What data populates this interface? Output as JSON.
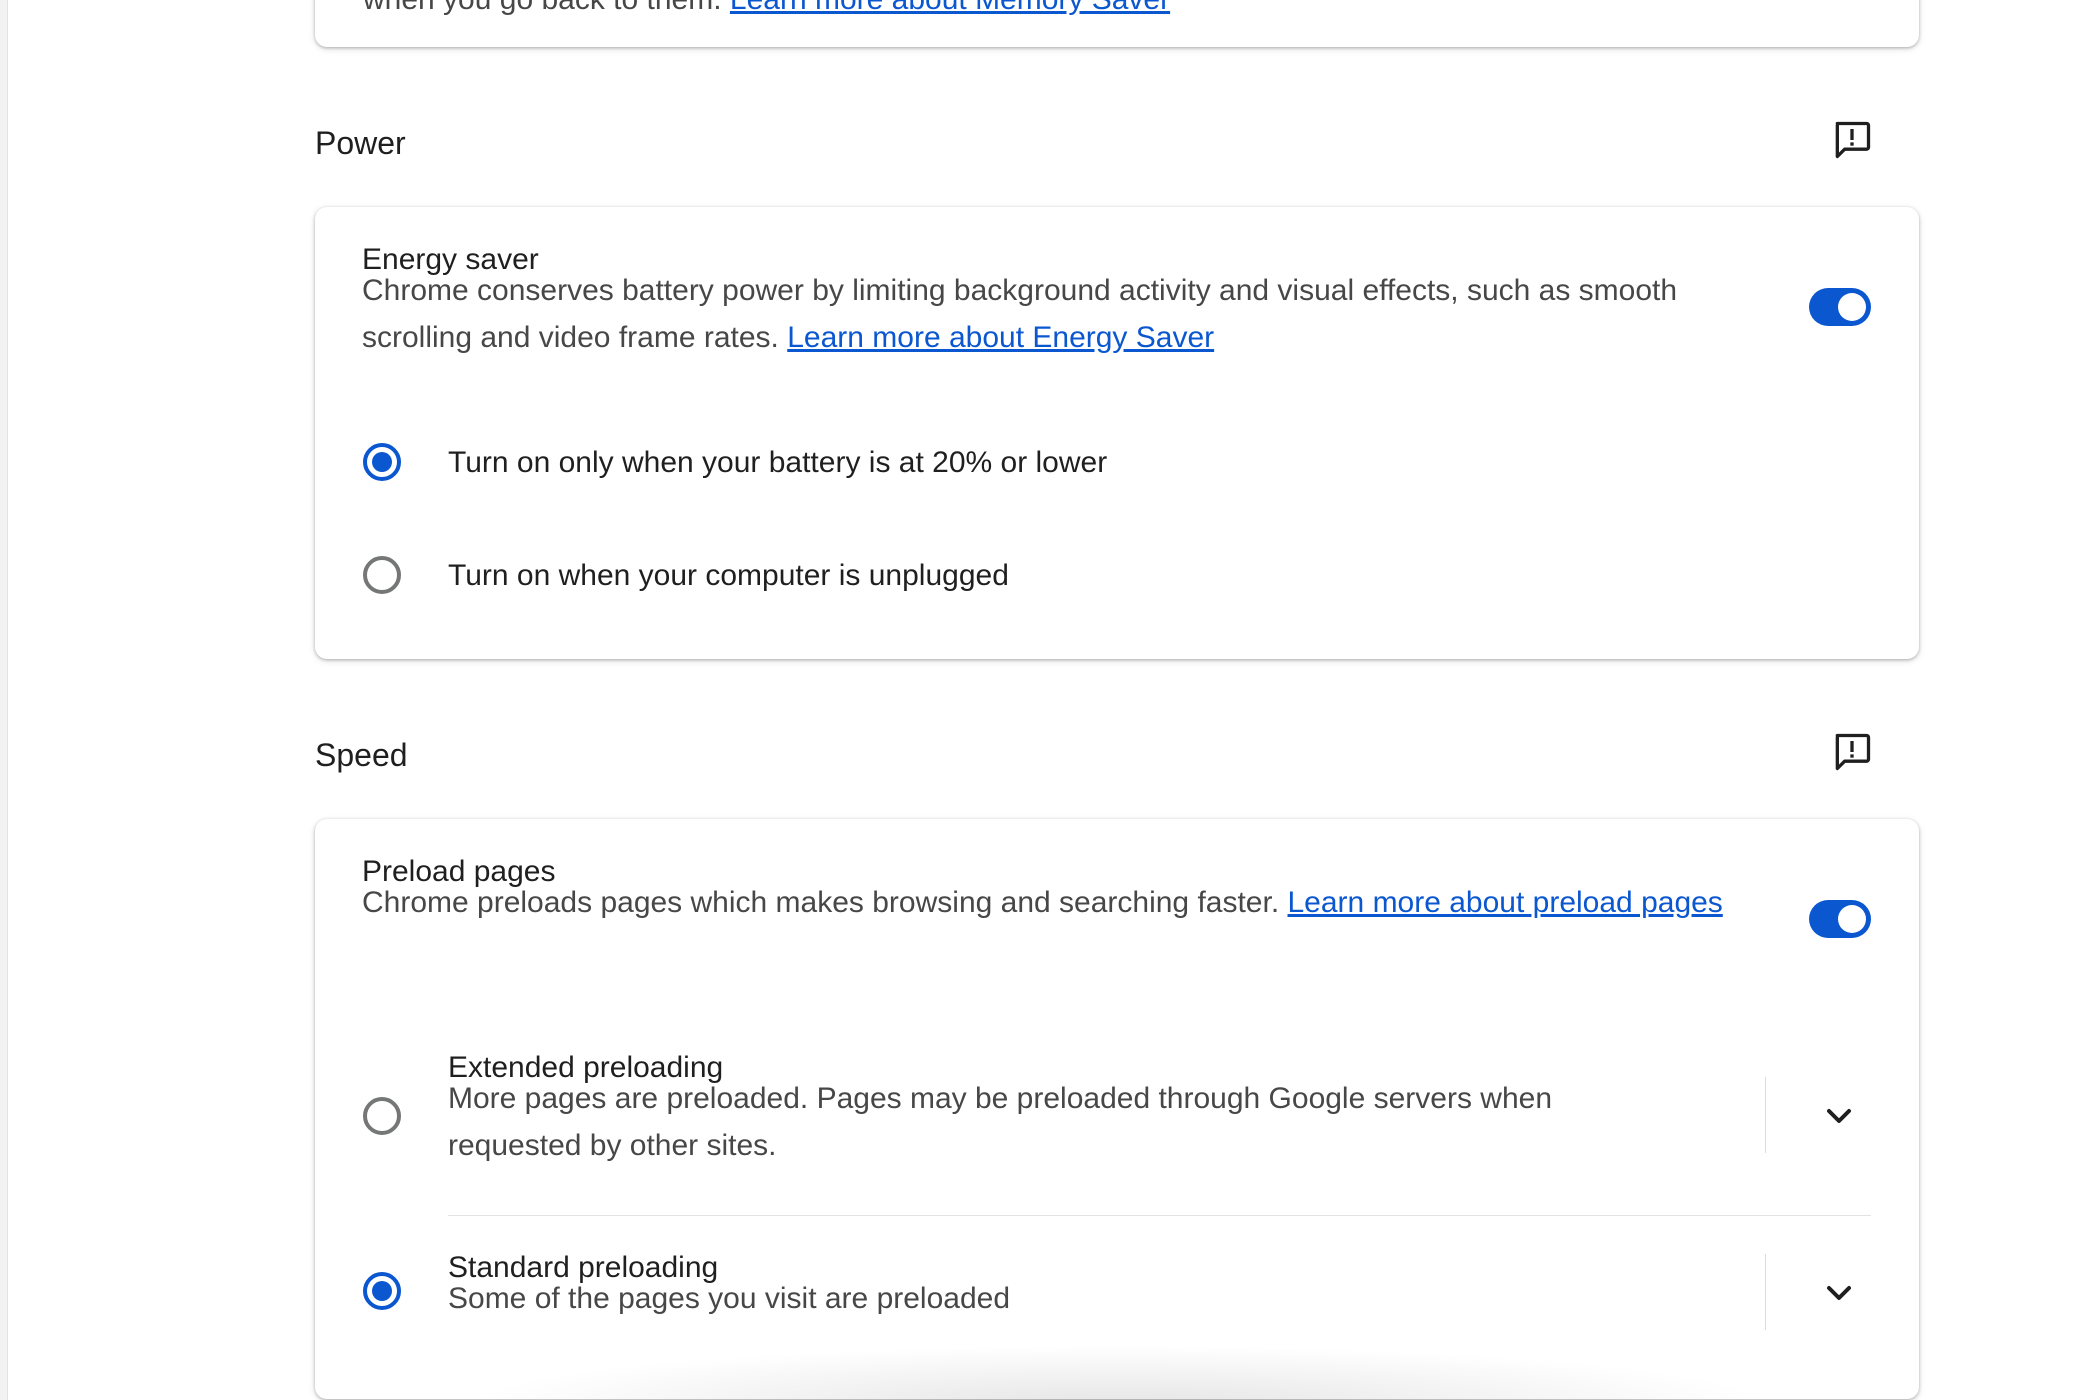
{
  "memory_card": {
    "text_prefix": "when you go back to them.",
    "link": "Learn more about Memory Saver"
  },
  "power": {
    "section_title": "Power",
    "energy_saver": {
      "title": "Energy saver",
      "desc": "Chrome conserves battery power by limiting background activity and visual effects, such as smooth scrolling and video frame rates.",
      "link": "Learn more about Energy Saver",
      "toggle_on": true
    },
    "options": [
      {
        "label": "Turn on only when your battery is at 20% or lower",
        "selected": true
      },
      {
        "label": "Turn on when your computer is unplugged",
        "selected": false
      }
    ]
  },
  "speed": {
    "section_title": "Speed",
    "preload": {
      "title": "Preload pages",
      "desc": "Chrome preloads pages which makes browsing and searching faster.",
      "link": "Learn more about preload pages",
      "toggle_on": true
    },
    "options": [
      {
        "title": "Extended preloading",
        "desc": "More pages are preloaded. Pages may be preloaded through Google servers when requested by other sites.",
        "selected": false
      },
      {
        "title": "Standard preloading",
        "desc": "Some of the pages you visit are preloaded",
        "selected": true
      }
    ]
  },
  "colors": {
    "accent": "#0b57d0",
    "text_primary": "#1f1f1f",
    "text_secondary": "#474747"
  },
  "icons": {
    "feedback": "feedback-icon",
    "expand": "chevron-down-icon"
  }
}
